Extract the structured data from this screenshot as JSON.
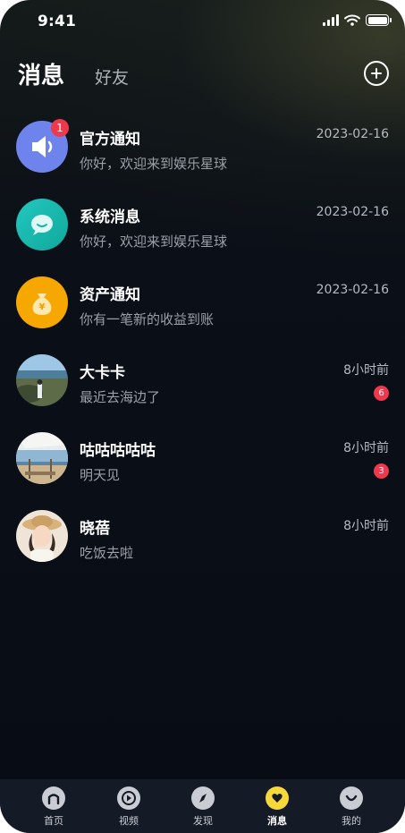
{
  "status_bar": {
    "time": "9:41"
  },
  "header": {
    "active_tab": "消息",
    "inactive_tab": "好友"
  },
  "conversations": [
    {
      "name": "官方通知",
      "preview": "你好，欢迎来到娱乐星球",
      "time": "2023-02-16",
      "badge": "1",
      "avatar": "speaker-icon",
      "avatar_color": "#6f83ec"
    },
    {
      "name": "系统消息",
      "preview": "你好，欢迎来到娱乐星球",
      "time": "2023-02-16",
      "badge": "",
      "avatar": "chat-bubble-icon",
      "avatar_color": "#1fbfae"
    },
    {
      "name": "资产通知",
      "preview": "你有一笔新的收益到账",
      "time": "2023-02-16",
      "badge": "",
      "avatar": "money-bag-icon",
      "avatar_color": "#f7a800"
    },
    {
      "name": "大卡卡",
      "preview": "最近去海边了",
      "time": "8小时前",
      "badge": "6",
      "avatar": "photo-avatar-seaside"
    },
    {
      "name": "咕咕咕咕咕",
      "preview": "明天见",
      "time": "8小时前",
      "badge": "3",
      "avatar": "photo-avatar-beach-house"
    },
    {
      "name": "晓蓓",
      "preview": "吃饭去啦",
      "time": "8小时前",
      "badge": "",
      "avatar": "photo-avatar-girl-hat"
    }
  ],
  "tabbar": [
    {
      "label": "首页",
      "icon": "home-icon"
    },
    {
      "label": "视频",
      "icon": "play-icon"
    },
    {
      "label": "发现",
      "icon": "compass-icon"
    },
    {
      "label": "消息",
      "icon": "heart-chat-icon",
      "active": true
    },
    {
      "label": "我的",
      "icon": "smile-icon"
    }
  ],
  "colors": {
    "accent": "#f7d83a",
    "badge": "#f0384c",
    "background": "#080c14"
  }
}
